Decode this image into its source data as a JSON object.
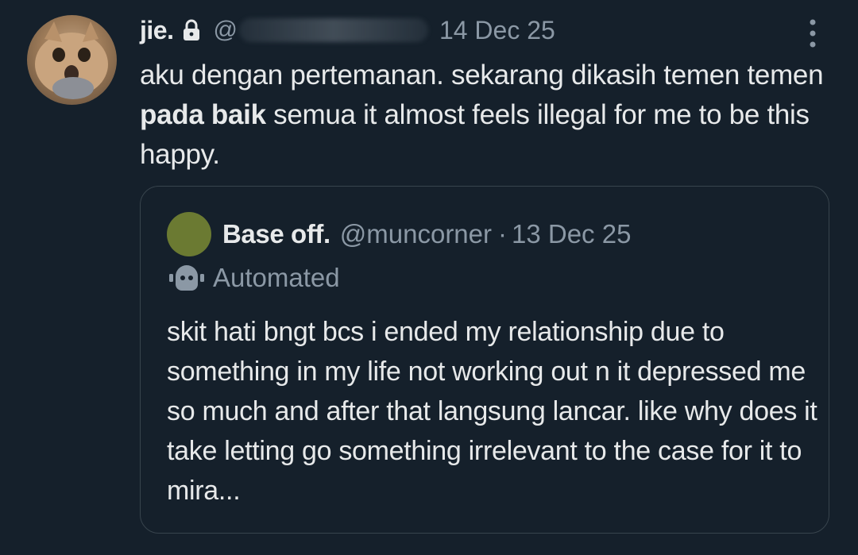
{
  "tweet": {
    "author_name": "jie.",
    "handle_prefix": "@",
    "date": "14 Dec 25",
    "text_before_bold": "aku dengan pertemanan. sekarang dikasih temen temen ",
    "text_bold": "pada baik",
    "text_after_bold": " semua it almost feels illegal for me to be this happy."
  },
  "quote": {
    "author_name": "Base off.",
    "handle": "@muncorner",
    "separator": "·",
    "date": "13 Dec 25",
    "automated_label": "Automated",
    "text": "skit hati bngt bcs i ended my relationship due to something in my life not working out n it depressed me so much and after that langsung lancar. like why does it take letting go something irrelevant to the case for it to mira..."
  },
  "icons": {
    "lock": "lock-icon",
    "more": "more-vertical-icon",
    "robot": "robot-icon"
  },
  "colors": {
    "background": "#15202b",
    "primary_text": "#e7e9ea",
    "secondary_text": "#8b98a5",
    "border": "#38444d",
    "quote_avatar": "#6b7a32"
  }
}
